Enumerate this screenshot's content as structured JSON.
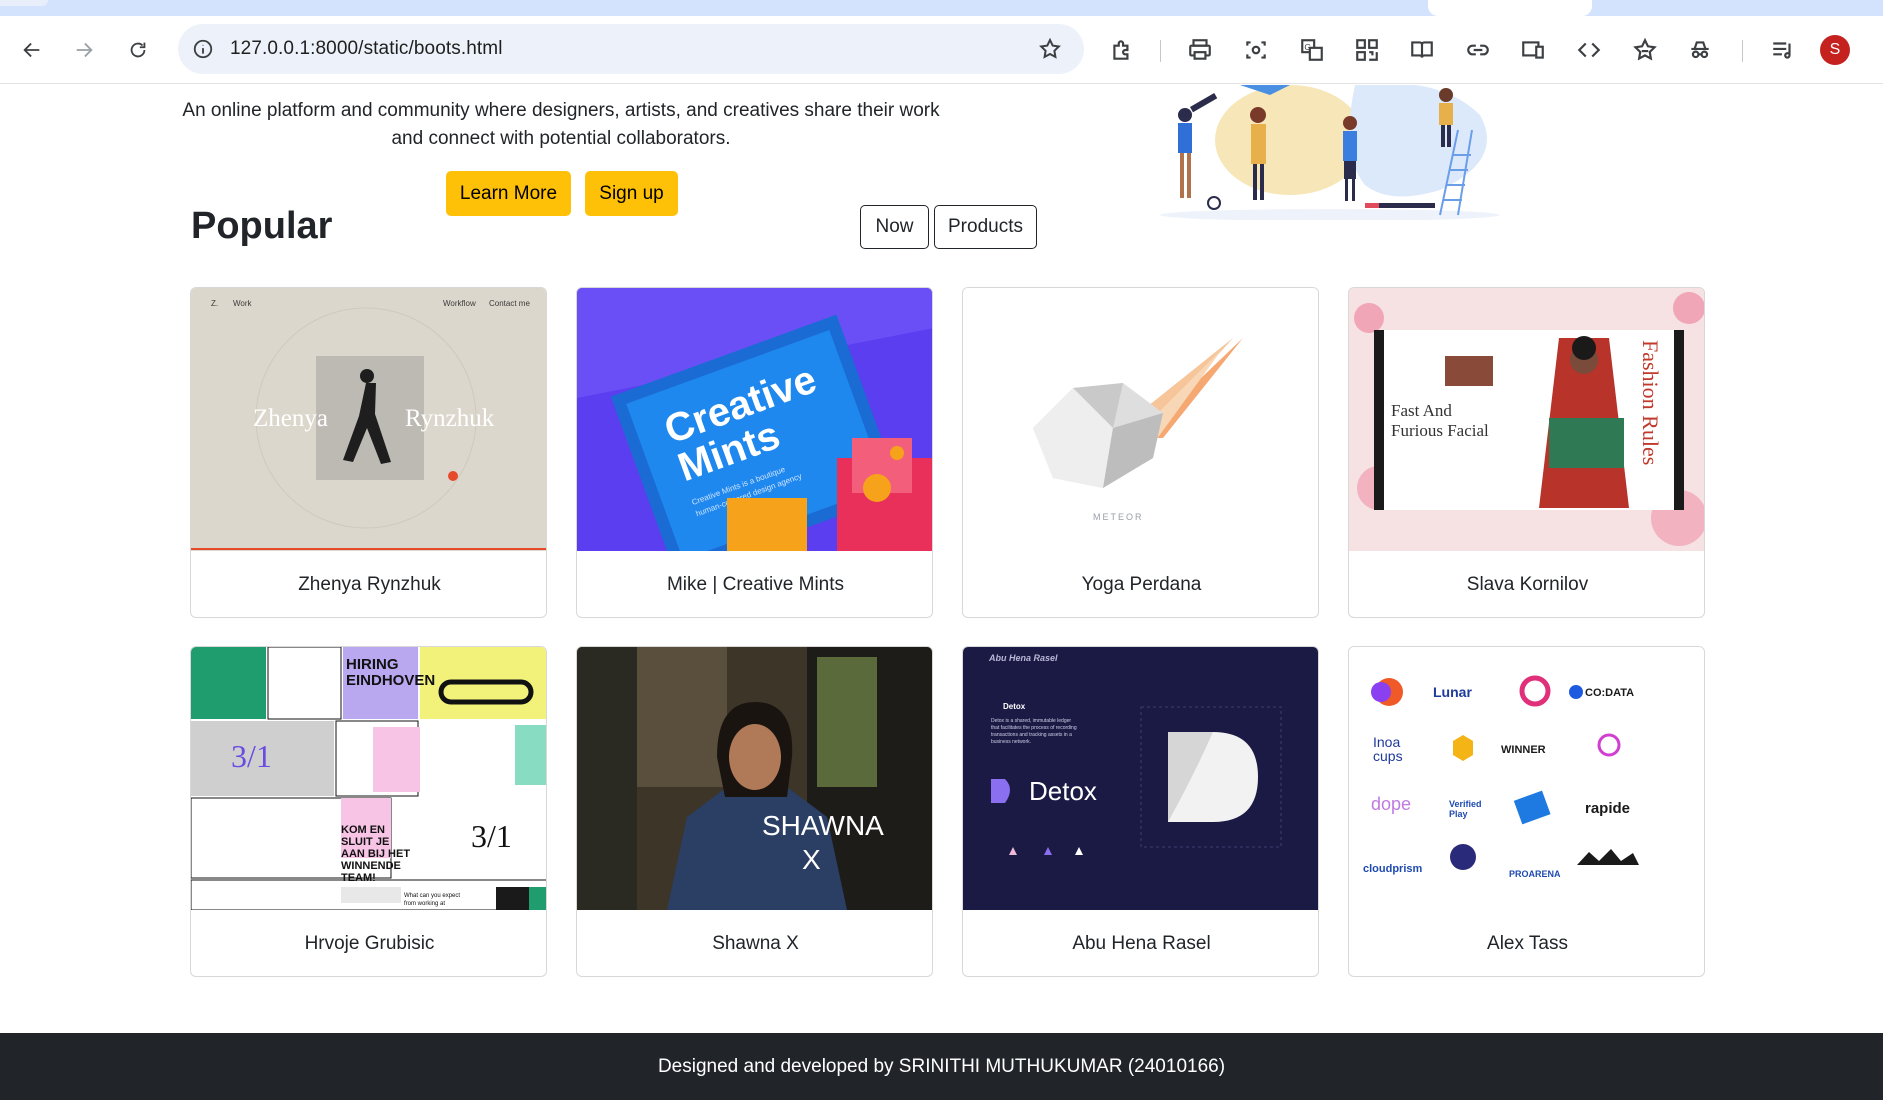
{
  "browser": {
    "url": "127.0.0.1:8000/static/boots.html",
    "profile_initial": "S",
    "icons": [
      "back-arrow-icon",
      "forward-arrow-icon",
      "reload-icon",
      "site-info-icon",
      "bookmark-star-icon",
      "extensions-icon",
      "print-icon",
      "screenshot-icon",
      "translate-icon",
      "qr-code-icon",
      "reading-mode-icon",
      "copy-link-icon",
      "cast-icon",
      "view-source-icon",
      "favorites-icon",
      "incognito-icon",
      "reading-list-icon"
    ]
  },
  "hero": {
    "description": "An online platform and community where designers, artists, and creatives share their work and connect with potential collaborators.",
    "learn_more": "Learn More",
    "sign_up": "Sign up"
  },
  "popular": {
    "title": "Popular",
    "filters": [
      "Now",
      "Products"
    ]
  },
  "cards": [
    {
      "name": "Zhenya Rynzhuk",
      "thumb_text": [
        "Zhenya",
        "Rynzhuk",
        "Work",
        "Workflow",
        "Contact me"
      ]
    },
    {
      "name": "Mike | Creative Mints",
      "thumb_text": [
        "Creative",
        "Mints",
        "Creative Mints is a boutique human-centered design agency"
      ]
    },
    {
      "name": "Yoga Perdana",
      "thumb_text": [
        "METEOR"
      ]
    },
    {
      "name": "Slava Kornilov",
      "thumb_text": [
        "Fast And",
        "Furious Facial",
        "Fashion Rules"
      ]
    },
    {
      "name": "Hrvoje Grubisic",
      "thumb_text": [
        "HIRING",
        "EINDHOVEN",
        "KOM EN",
        "SLUIT JE",
        "AAN BIJ HET",
        "WINNENDE",
        "TEAM!",
        "What can you expect from working at"
      ]
    },
    {
      "name": "Shawna X",
      "thumb_text": [
        "SHAWNA",
        "X"
      ]
    },
    {
      "name": "Abu Hena Rasel",
      "thumb_text": [
        "Abu Hena Rasel",
        "Detox",
        "Detox is a shared, immutable ledger that facilitates the process of recording transactions and tracking assets in a business network."
      ]
    },
    {
      "name": "Alex Tass",
      "thumb_text": [
        "Lunar",
        "CO:DATA",
        "Inoa cups",
        "WINNER",
        "dope",
        "Verified Play",
        "rapide",
        "cloudprism",
        "PROARENA"
      ]
    }
  ],
  "footer": {
    "text": "Designed and developed by SRINITHI MUTHUKUMAR (24010166)"
  }
}
